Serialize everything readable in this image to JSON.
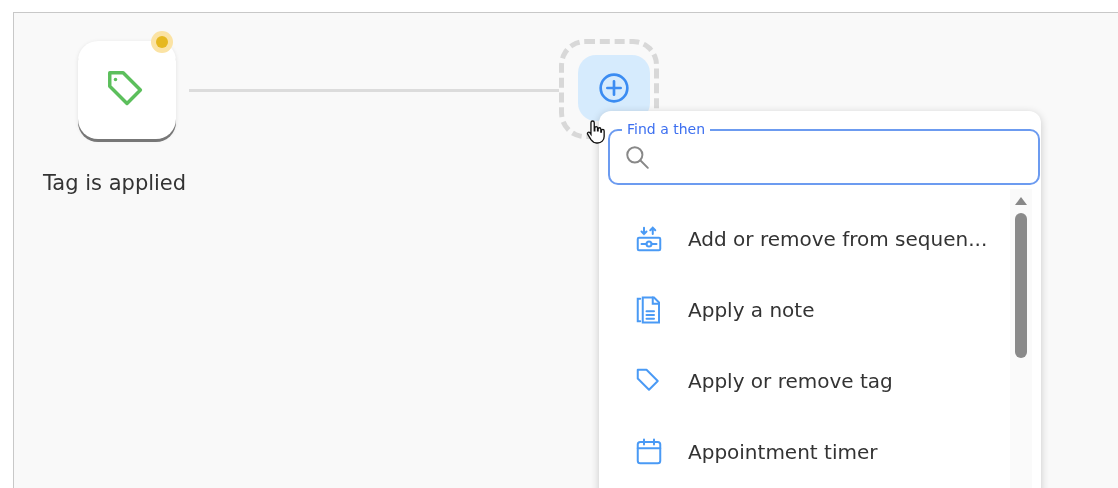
{
  "trigger": {
    "label": "Tag is applied",
    "alert": true
  },
  "search": {
    "label": "Find a then"
  },
  "actions": [
    {
      "kind": "sequence",
      "label": "Add or remove from sequen..."
    },
    {
      "kind": "note",
      "label": "Apply a note"
    },
    {
      "kind": "tag",
      "label": "Apply or remove tag"
    },
    {
      "kind": "timer",
      "label": "Appointment timer"
    }
  ]
}
